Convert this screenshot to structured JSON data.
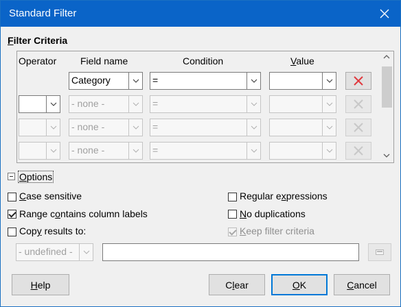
{
  "window": {
    "title": "Standard Filter"
  },
  "section": {
    "filter_criteria": "Filter Criteria"
  },
  "columns": {
    "operator": "Operator",
    "field_name": "Field name",
    "condition": "Condition",
    "value": "Value"
  },
  "rows": [
    {
      "operator": "",
      "field": "Category",
      "condition": "=",
      "value": "",
      "enabled": true
    },
    {
      "operator": "",
      "field": "- none -",
      "condition": "=",
      "value": "",
      "enabled": false
    },
    {
      "operator": "",
      "field": "- none -",
      "condition": "=",
      "value": "",
      "enabled": false
    },
    {
      "operator": "",
      "field": "- none -",
      "condition": "=",
      "value": "",
      "enabled": false
    }
  ],
  "options": {
    "label": "Options",
    "case_sensitive": {
      "label": "Case sensitive",
      "checked": false
    },
    "range_contains_labels": {
      "label": "Range contains column labels",
      "checked": true
    },
    "copy_results": {
      "label": "Copy results to:",
      "checked": false
    },
    "regular_expressions": {
      "label": "Regular expressions",
      "checked": false
    },
    "no_duplications": {
      "label": "No duplications",
      "checked": false
    },
    "keep_filter_criteria": {
      "label": "Keep filter criteria",
      "checked": true,
      "enabled": false
    },
    "copy_target_select": "- undefined -",
    "copy_target_input": ""
  },
  "buttons": {
    "help": "Help",
    "clear": "Clear",
    "ok": "OK",
    "cancel": "Cancel"
  },
  "colors": {
    "titlebar": "#0a64c8",
    "delete_active": "#e0383e",
    "default_button_border": "#0078d7"
  }
}
